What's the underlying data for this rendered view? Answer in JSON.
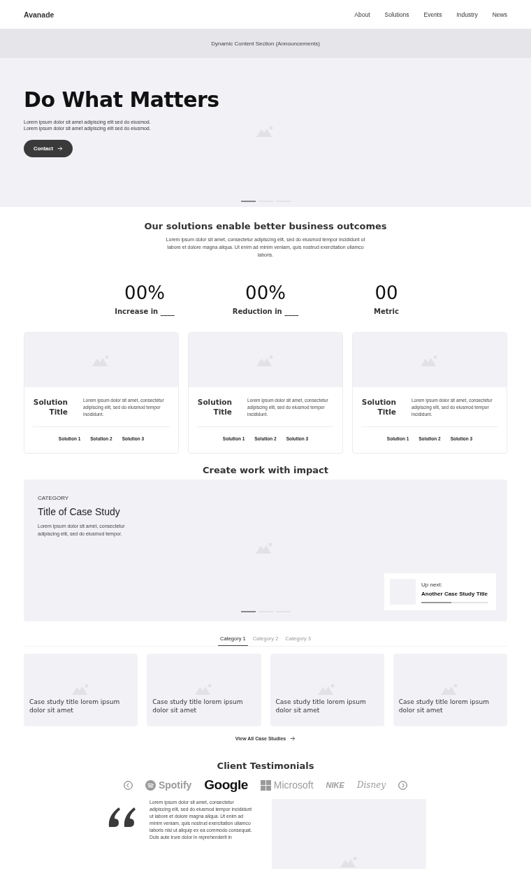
{
  "nav": {
    "brand": "Avanade",
    "links": [
      "About",
      "Solutions",
      "Events",
      "Industry",
      "News"
    ]
  },
  "announcement": "Dynamic Content Section (Announcements)",
  "hero": {
    "title": "Do What Matters",
    "lines": [
      "Lorem ipsum dolor sit amet adipiscing elit sed do eiusmod.",
      "Lorem ipsum dolor sit amet adipiscing elit sed do eiusmod."
    ],
    "button": "Contact",
    "dots": [
      {
        "selected": true
      },
      {
        "selected": false
      },
      {
        "selected": false
      }
    ]
  },
  "intro": {
    "title": "Our solutions enable better business outcomes",
    "text": "Lorem ipsum dolor sit amet, consectetur adipiscing elit, sed do eiusmod tempor incididunt ut labore et dolore magna aliqua. Ut enim ad minim veniam, quis nostrud exercitation ullamco laboris."
  },
  "metrics": [
    {
      "value": "00%",
      "label": "Increase in ____"
    },
    {
      "value": "00%",
      "label": "Reduction in ____"
    },
    {
      "value": "00",
      "label": "Metric"
    }
  ],
  "solutions": [
    {
      "title": "Solution Title",
      "text": "Lorem ipsum dolor sit amet, consectetur adipiscing elit, sed do eiusmod tempor incididunt.",
      "links": [
        "Solution 1",
        "Solution 2",
        "Solution 3"
      ]
    },
    {
      "title": "Solution Title",
      "text": "Lorem ipsum dolor sit amet, consectetur adipiscing elit, sed do eiusmod tempor incididunt.",
      "links": [
        "Solution 1",
        "Solution 2",
        "Solution 3"
      ]
    },
    {
      "title": "Solution Title",
      "text": "Lorem ipsum dolor sit amet, consectetur adipiscing elit, sed do eiusmod tempor incididunt.",
      "links": [
        "Solution 1",
        "Solution 2",
        "Solution 3"
      ]
    }
  ],
  "impact": {
    "title": "Create work with impact",
    "category": "CATEGORY",
    "case_title": "Title of Case Study",
    "text": "Lorem ipsum dolor sit amet, consectetur adipiscing elit, sed do eiusmod tempor.",
    "up_next": {
      "label": "Up next:",
      "title": "Another Case Study Title",
      "level": 0.45
    },
    "dots": [
      {
        "selected": true
      },
      {
        "selected": false
      },
      {
        "selected": false
      }
    ]
  },
  "tabs": [
    {
      "label": "Category 1",
      "selected": true
    },
    {
      "label": "Category 2",
      "selected": false
    },
    {
      "label": "Category 3",
      "selected": false
    }
  ],
  "case_studies": [
    "Case study title lorem ipsum dolor sit amet",
    "Case study title lorem ipsum dolor sit amet",
    "Case study title lorem ipsum dolor sit amet",
    "Case study title lorem ipsum dolor sit amet"
  ],
  "view_all": "View All Case Studies",
  "testimonials": {
    "title": "Client Testimonials",
    "logos": [
      {
        "kind": "spotify",
        "name": "Spotify",
        "selected": false
      },
      {
        "kind": "google",
        "name": "Google",
        "selected": true
      },
      {
        "kind": "microsoft",
        "name": "Microsoft",
        "selected": false
      },
      {
        "kind": "nike",
        "name": "NIKE",
        "selected": false
      },
      {
        "kind": "disney",
        "name": "Disney",
        "selected": false
      }
    ],
    "quote": "Lorem ipsum dolor sit amet, consectetur adipiscing elit, sed do eiusmod tempor incididunt ut labore et dolore magna aliqua. Ut enim ad minim veniam, quis nostrud exercitation ullamco laboris nisi ut aliquip ex ea commodo consequat. Duis aute irure dolor in reprehenderit in"
  }
}
